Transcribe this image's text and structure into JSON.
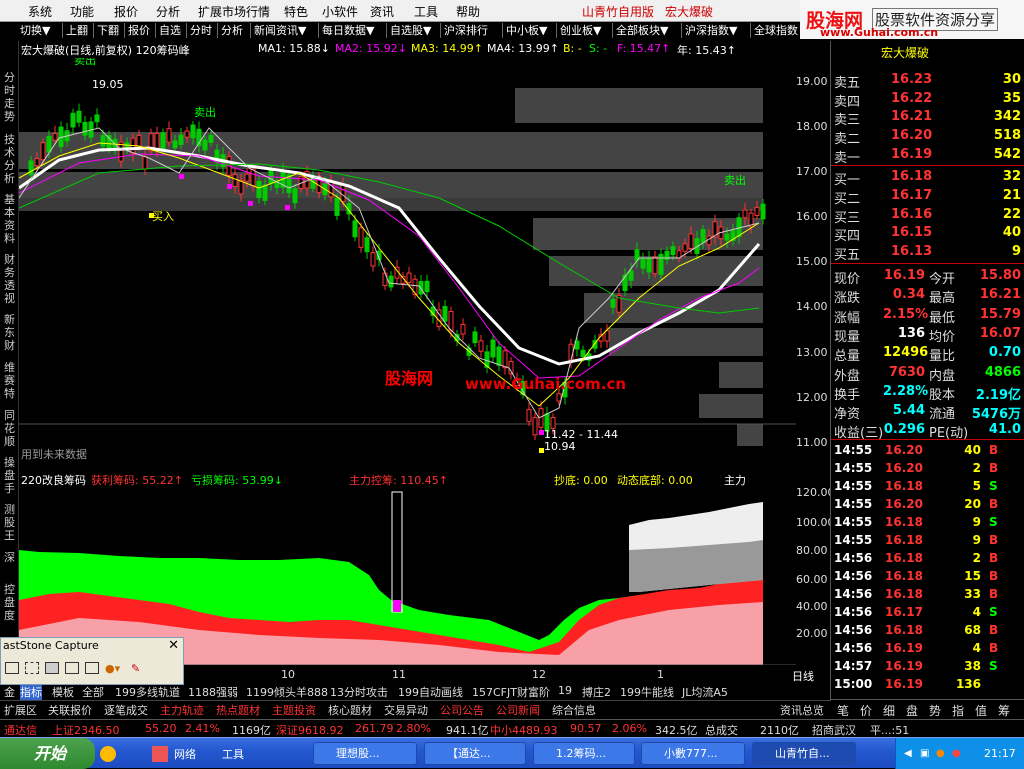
{
  "menu": {
    "items": [
      "系统",
      "功能",
      "报价",
      "分析",
      "扩展市场行情",
      "特色",
      "小软件",
      "资讯",
      "工具",
      "帮助"
    ],
    "app_label": "山青竹自用版",
    "stock_label": "宏大爆破"
  },
  "toolbar": {
    "items": [
      "切换▼",
      "上翻",
      "下翻",
      "报价",
      "自选",
      "分时",
      "分析",
      "新闻资讯▼",
      "每日数据▼",
      "自选股▼",
      "沪深排行",
      "中小板▼",
      "创业板▼",
      "全部板块▼",
      "沪深指数▼",
      "全球指数"
    ]
  },
  "logo": {
    "name": "股海网",
    "slogan": "股票软件资源分享",
    "url": "www.Guhai.com.cn"
  },
  "leftnav": [
    "分时走势",
    "技术分析",
    "基本资料",
    "财务透视",
    "新东财",
    "维赛特",
    "同花顺",
    "操盘手",
    "测股王",
    "深",
    "控盘度"
  ],
  "chart_header": {
    "title": "宏大爆破(日线,前复权) 120筹码峰",
    "ma1": "MA1: 15.88↓",
    "ma2": "MA2: 15.92↓",
    "ma3": "MA3: 14.99↑",
    "ma4": "MA4: 13.99↑",
    "b": "B: -",
    "s": "S: -",
    "f": "F: 15.47↑",
    "year": "年: 15.43↑"
  },
  "chart_annotations": {
    "high_label": "19.05",
    "low_label": "11.42 - 11.44",
    "low_price": "10.94",
    "sell1": "卖出",
    "sell2": "卖出",
    "sell3": "卖出",
    "buy1": "买入",
    "future": "用到未来数据",
    "watermark1": "股海网",
    "watermark2": "www.Guhai.com.cn"
  },
  "price_axis": [
    "19.00",
    "18.00",
    "17.00",
    "16.00",
    "15.00",
    "14.00",
    "13.00",
    "12.00",
    "11.00"
  ],
  "indicator_header": {
    "name": "220改良筹码",
    "profit": "获利筹码: 55.22↑",
    "loss": "亏损筹码: 53.99↓",
    "control": "主力控筹: 110.45↑",
    "bottom": "抄底: 0.00",
    "dyn_bottom": "动态底部: 0.00",
    "main": "主力"
  },
  "ind_axis": [
    "120.00",
    "100.00",
    "80.00",
    "60.00",
    "40.00",
    "20.00"
  ],
  "x_axis": {
    "labels": [
      "10",
      "11",
      "12",
      "1"
    ],
    "period": "日线"
  },
  "quote": {
    "title": "宏大爆破",
    "asks": [
      {
        "label": "卖五",
        "price": "16.23",
        "vol": "30"
      },
      {
        "label": "卖四",
        "price": "16.22",
        "vol": "35"
      },
      {
        "label": "卖三",
        "price": "16.21",
        "vol": "342"
      },
      {
        "label": "卖二",
        "price": "16.20",
        "vol": "518"
      },
      {
        "label": "卖一",
        "price": "16.19",
        "vol": "542"
      }
    ],
    "bids": [
      {
        "label": "买一",
        "price": "16.18",
        "vol": "32"
      },
      {
        "label": "买二",
        "price": "16.17",
        "vol": "21"
      },
      {
        "label": "买三",
        "price": "16.16",
        "vol": "22"
      },
      {
        "label": "买四",
        "price": "16.15",
        "vol": "40"
      },
      {
        "label": "买五",
        "price": "16.13",
        "vol": "9"
      }
    ],
    "stats": [
      {
        "l1": "现价",
        "v1": "16.19",
        "l2": "今开",
        "v2": "15.80"
      },
      {
        "l1": "涨跌",
        "v1": "0.34",
        "l2": "最高",
        "v2": "16.21"
      },
      {
        "l1": "涨幅",
        "v1": "2.15%",
        "l2": "最低",
        "v2": "15.79"
      },
      {
        "l1": "现量",
        "v1": "136",
        "l2": "均价",
        "v2": "16.07"
      },
      {
        "l1": "总量",
        "v1": "12496",
        "l2": "量比",
        "v2": "0.70"
      },
      {
        "l1": "外盘",
        "v1": "7630",
        "l2": "内盘",
        "v2": "4866"
      },
      {
        "l1": "换手",
        "v1": "2.28%",
        "l2": "股本",
        "v2": "2.19亿"
      },
      {
        "l1": "净资",
        "v1": "5.44",
        "l2": "流通",
        "v2": "5476万"
      },
      {
        "l1": "收益(三)",
        "v1": "0.296",
        "l2": "PE(动)",
        "v2": "41.0"
      }
    ],
    "ticks": [
      {
        "t": "14:55",
        "p": "16.20",
        "v": "40",
        "d": "B"
      },
      {
        "t": "14:55",
        "p": "16.20",
        "v": "2",
        "d": "B"
      },
      {
        "t": "14:55",
        "p": "16.18",
        "v": "5",
        "d": "S"
      },
      {
        "t": "14:55",
        "p": "16.20",
        "v": "20",
        "d": "B"
      },
      {
        "t": "14:55",
        "p": "16.18",
        "v": "9",
        "d": "S"
      },
      {
        "t": "14:55",
        "p": "16.18",
        "v": "9",
        "d": "B"
      },
      {
        "t": "14:56",
        "p": "16.18",
        "v": "2",
        "d": "B"
      },
      {
        "t": "14:56",
        "p": "16.18",
        "v": "15",
        "d": "B"
      },
      {
        "t": "14:56",
        "p": "16.18",
        "v": "33",
        "d": "B"
      },
      {
        "t": "14:56",
        "p": "16.17",
        "v": "4",
        "d": "S"
      },
      {
        "t": "14:56",
        "p": "16.18",
        "v": "68",
        "d": "B"
      },
      {
        "t": "14:56",
        "p": "16.19",
        "v": "4",
        "d": "B"
      },
      {
        "t": "14:57",
        "p": "16.19",
        "v": "38",
        "d": "S"
      },
      {
        "t": "15:00",
        "p": "16.19",
        "v": "136",
        "d": ""
      }
    ],
    "bottom_tabs": [
      "笔",
      "价",
      "细",
      "盘",
      "势",
      "指",
      "值",
      "筹"
    ]
  },
  "tabs1": [
    "金",
    "指标",
    "模板",
    "全部",
    "199多线轨道",
    "1188强弱",
    "1199倾头羊888",
    "13分时攻击",
    "199自动画线",
    "157CFJT财富阶",
    "19",
    "搏庄2",
    "199牛能线",
    "JL均流A5"
  ],
  "tabs2": [
    "扩展区",
    "关联报价",
    "逐笔成交",
    "主力轨迹",
    "热点题材",
    "主题投资",
    "核心题材",
    "交易异动",
    "公司公告",
    "公司新闻",
    "综合信息"
  ],
  "tabs2_right": "资讯总览",
  "ticker": {
    "name": "通达信",
    "sh": "上证2346.50",
    "sh_chg": "55.20",
    "sh_pct": "2.41%",
    "sh_amt": "1169亿",
    "sz": "深证9618.92",
    "sz_chg": "261.79",
    "sz_pct": "2.80%",
    "sz_amt": "941.1亿",
    "zx": "中小4489.93",
    "zx_chg": "90.57",
    "zx_pct": "2.06%",
    "zx_amt": "342.5亿",
    "total": "总成交",
    "total_amt": "2110亿",
    "broker": "招商武汉",
    "extra": "平...:51"
  },
  "popup": {
    "title": "astStone Capture"
  },
  "taskbar": {
    "start": "开始",
    "quick": [
      "网络",
      "工具"
    ],
    "tasks": [
      "理想股...",
      "【通达...",
      "1.2筹码...",
      "小數777...",
      "山青竹自..."
    ],
    "clock": "21:17"
  }
}
